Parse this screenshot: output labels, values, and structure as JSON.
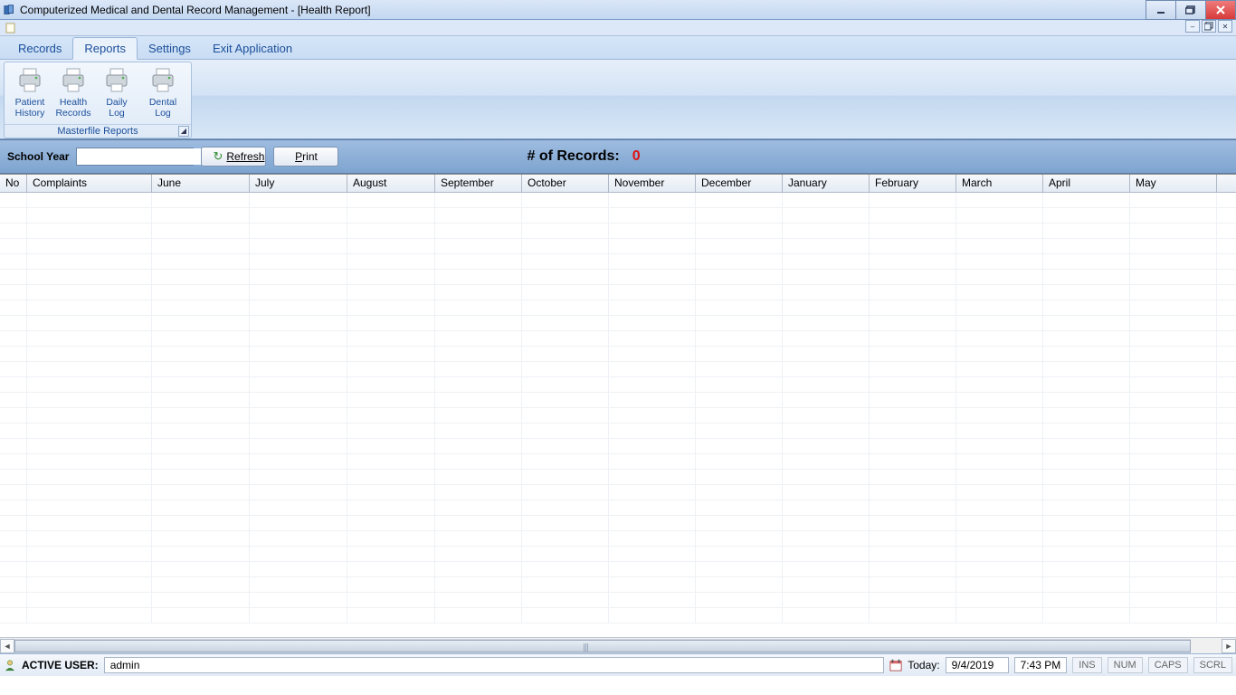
{
  "window": {
    "title": "Computerized Medical and Dental Record Management - [Health Report]"
  },
  "menu": {
    "items": [
      "Records",
      "Reports",
      "Settings",
      "Exit Application"
    ],
    "active_index": 1
  },
  "ribbon": {
    "group_caption": "Masterfile Reports",
    "buttons": [
      {
        "line1": "Patient",
        "line2": "History"
      },
      {
        "line1": "Health",
        "line2": "Records"
      },
      {
        "line1": "Daily",
        "line2": "Log"
      },
      {
        "line1": "Dental Log",
        "line2": ""
      }
    ]
  },
  "filter": {
    "school_year_label": "School Year",
    "school_year_value": "",
    "refresh_label": "Refresh",
    "print_label": "Print",
    "records_label": "# of Records:",
    "records_count": "0"
  },
  "grid": {
    "columns": [
      {
        "label": "No",
        "width": 30
      },
      {
        "label": "Complaints",
        "width": 138
      },
      {
        "label": "June",
        "width": 108
      },
      {
        "label": "July",
        "width": 108
      },
      {
        "label": "August",
        "width": 97
      },
      {
        "label": "September",
        "width": 96
      },
      {
        "label": "October",
        "width": 96
      },
      {
        "label": "November",
        "width": 96
      },
      {
        "label": "December",
        "width": 96
      },
      {
        "label": "January",
        "width": 96
      },
      {
        "label": "February",
        "width": 96
      },
      {
        "label": "March",
        "width": 96
      },
      {
        "label": "April",
        "width": 96
      },
      {
        "label": "May",
        "width": 96
      }
    ],
    "rows": []
  },
  "status": {
    "active_user_label": "ACTIVE USER:",
    "active_user_value": "admin",
    "today_label": "Today:",
    "today_value": "9/4/2019",
    "time_value": "7:43 PM",
    "indicators": [
      "INS",
      "NUM",
      "CAPS",
      "SCRL"
    ]
  }
}
